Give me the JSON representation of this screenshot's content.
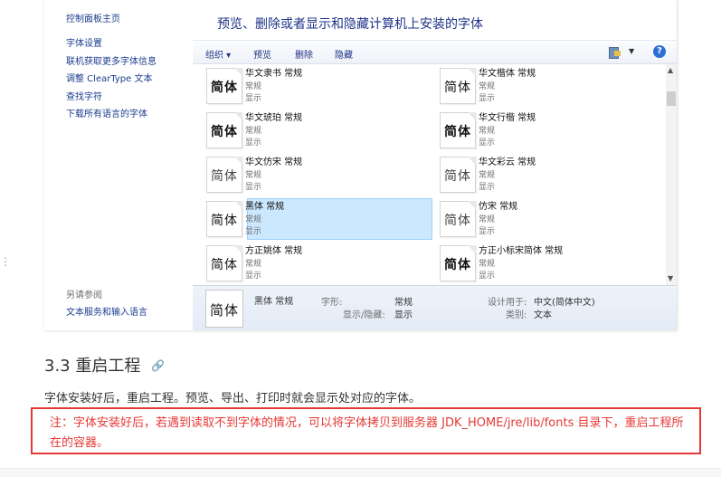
{
  "control_panel": {
    "sidebar": {
      "home": "控制面板主页",
      "links": [
        "字体设置",
        "联机获取更多字体信息",
        "调整 ClearType 文本",
        "查找字符",
        "下载所有语言的字体"
      ],
      "see_also_title": "另请参阅",
      "see_also_link": "文本服务和输入语言"
    },
    "title": "预览、删除或者显示和隐藏计算机上安装的字体",
    "toolbar": {
      "organize": "组织 ▾",
      "preview": "预览",
      "delete": "删除",
      "hide": "隐藏",
      "help": "?"
    },
    "fonts": [
      {
        "name": "华文隶书 常规",
        "style": "常规",
        "show": "显示",
        "sample": "简体",
        "variant": "bold"
      },
      {
        "name": "华文楷体 常规",
        "style": "常规",
        "show": "显示",
        "sample": "简体",
        "variant": "normal"
      },
      {
        "name": "华文琥珀 常规",
        "style": "常规",
        "show": "显示",
        "sample": "简体",
        "variant": "bold"
      },
      {
        "name": "华文行楷 常规",
        "style": "常规",
        "show": "显示",
        "sample": "简体",
        "variant": "bold"
      },
      {
        "name": "华文仿宋 常规",
        "style": "常规",
        "show": "显示",
        "sample": "简体",
        "variant": "light"
      },
      {
        "name": "华文彩云 常规",
        "style": "常规",
        "show": "显示",
        "sample": "简体",
        "variant": "light"
      },
      {
        "name": "黑体 常规",
        "style": "常规",
        "show": "显示",
        "sample": "简体",
        "variant": "normal",
        "selected": true
      },
      {
        "name": "仿宋 常规",
        "style": "常规",
        "show": "显示",
        "sample": "简体",
        "variant": "light"
      },
      {
        "name": "方正姚体 常规",
        "style": "常规",
        "show": "显示",
        "sample": "简体",
        "variant": "normal"
      },
      {
        "name": "方正小标宋简体 常规",
        "style": "常规",
        "show": "显示",
        "sample": "简体",
        "variant": "bold"
      }
    ],
    "details": {
      "sample": "简体",
      "name": "黑体 常规",
      "shape_label": "字形:",
      "shape_value": "常规",
      "visibility_label": "显示/隐藏:",
      "visibility_value": "显示",
      "designed_for_label": "设计用于:",
      "designed_for_value": "中文(简体中文)",
      "category_label": "类别:",
      "category_value": "文本"
    }
  },
  "article": {
    "heading": "3.3 重启工程",
    "link_icon": "🔗",
    "paragraph": "字体安装好后，重启工程。预览、导出、打印时就会显示处对应的字体。",
    "note": "注：字体安装好后，若遇到读取不到字体的情况，可以将字体拷贝到服务器 JDK_HOME/jre/lib/fonts 目录下，重启工程所在的容器。",
    "note_border_color": "#e53935"
  }
}
